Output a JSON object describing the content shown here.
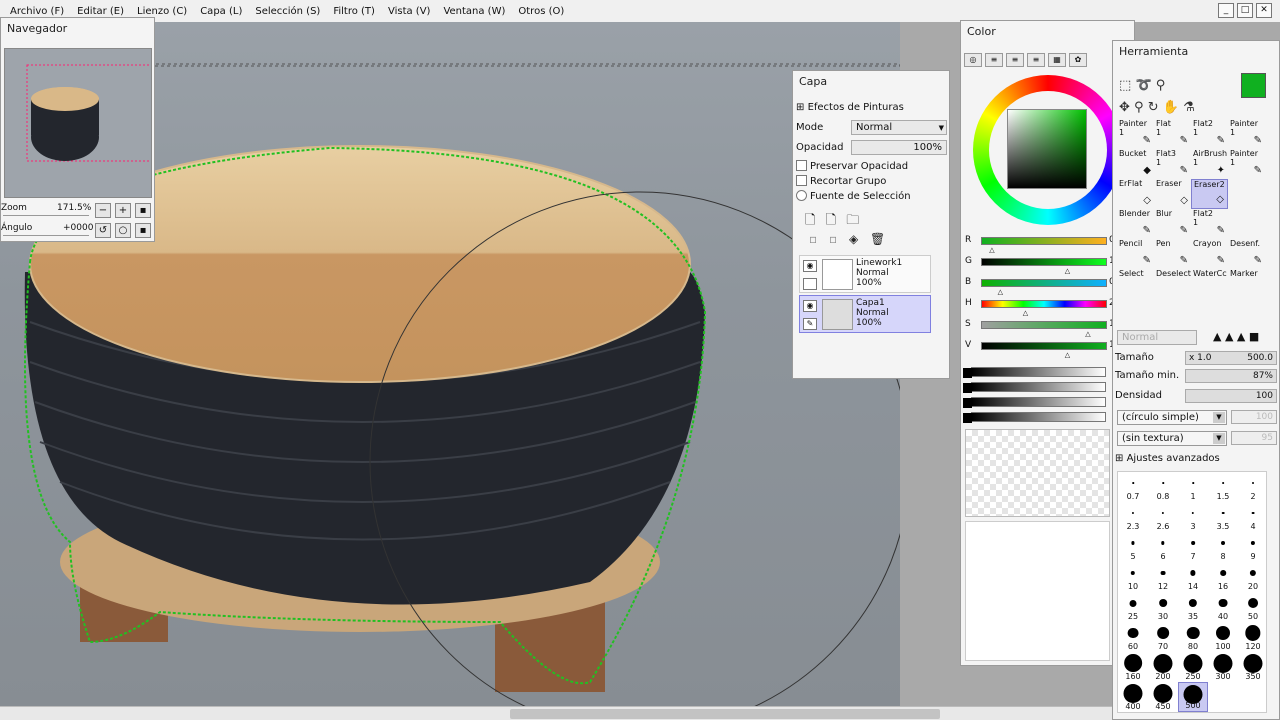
{
  "menu": [
    "Archivo (F)",
    "Editar (E)",
    "Lienzo (C)",
    "Capa (L)",
    "Selección (S)",
    "Filtro (T)",
    "Vista (V)",
    "Ventana (W)",
    "Otros (O)"
  ],
  "window_controls": [
    "_",
    "□",
    "✕"
  ],
  "navigator": {
    "title": "Navegador",
    "zoom_label": "Zoom",
    "zoom_value": "171.5%",
    "angle_label": "Ángulo",
    "angle_value": "+0000"
  },
  "layers": {
    "title": "Capa",
    "effects_label": "Efectos de Pinturas",
    "mode_label": "Mode",
    "mode_value": "Normal",
    "opacity_label": "Opacidad",
    "opacity_value": "100%",
    "preserve_opacity": "Preservar Opacidad",
    "clip_group": "Recortar Grupo",
    "selection_source": "Fuente de Selección",
    "items": [
      {
        "name": "Linework1",
        "mode": "Normal",
        "opacity": "100%"
      },
      {
        "name": "Capa1",
        "mode": "Normal",
        "opacity": "100%"
      }
    ]
  },
  "color": {
    "title": "Color",
    "current_hex": "#10b020",
    "channels": [
      {
        "label": "R",
        "value": "0",
        "level": 0.06
      },
      {
        "label": "G",
        "value": "1",
        "level": 0.69
      },
      {
        "label": "B",
        "value": "0",
        "level": 0.13
      },
      {
        "label": "H",
        "value": "2",
        "level": 0.34
      },
      {
        "label": "S",
        "value": "1",
        "level": 0.86
      },
      {
        "label": "V",
        "value": "1",
        "level": 0.69
      }
    ]
  },
  "tool": {
    "title": "Herramienta",
    "tools": [
      {
        "name": "Painter",
        "num": "1",
        "icon": "✎"
      },
      {
        "name": "Flat",
        "num": "1",
        "icon": "✎"
      },
      {
        "name": "Flat2",
        "num": "1",
        "icon": "✎"
      },
      {
        "name": "Painter",
        "num": "1",
        "icon": "✎"
      },
      {
        "name": "Bucket",
        "num": "",
        "icon": "◆"
      },
      {
        "name": "Flat3",
        "num": "1",
        "icon": "✎"
      },
      {
        "name": "AirBrush",
        "num": "1",
        "icon": "✦"
      },
      {
        "name": "Painter",
        "num": "1",
        "icon": "✎"
      },
      {
        "name": "ErFlat",
        "num": "",
        "icon": "◇"
      },
      {
        "name": "Eraser",
        "num": "",
        "icon": "◇"
      },
      {
        "name": "Eraser2",
        "num": "",
        "icon": "◇"
      },
      {
        "name": "",
        "num": "",
        "icon": ""
      },
      {
        "name": "Blender",
        "num": "",
        "icon": "✎"
      },
      {
        "name": "Blur",
        "num": "",
        "icon": "✎"
      },
      {
        "name": "Flat2",
        "num": "1",
        "icon": "✎"
      },
      {
        "name": "",
        "num": "",
        "icon": ""
      },
      {
        "name": "Pencil",
        "num": "",
        "icon": "✎"
      },
      {
        "name": "Pen",
        "num": "",
        "icon": "✎"
      },
      {
        "name": "Crayon",
        "num": "",
        "icon": "✎"
      },
      {
        "name": "Desenf.",
        "num": "",
        "icon": "✎"
      },
      {
        "name": "Select",
        "num": "",
        "icon": ""
      },
      {
        "name": "Deselect",
        "num": "",
        "icon": ""
      },
      {
        "name": "WaterCc",
        "num": "",
        "icon": ""
      },
      {
        "name": "Marker",
        "num": "",
        "icon": ""
      }
    ],
    "blend_value": "Normal",
    "size_label": "Tamaño",
    "size_mult": "x 1.0",
    "size_value": "500.0",
    "min_size_label": "Tamaño min.",
    "min_size_value": "87%",
    "density_label": "Densidad",
    "density_value": "100",
    "shape_value": "(círculo simple)",
    "shape_num": "100",
    "texture_value": "(sin textura)",
    "texture_num": "95",
    "advanced_label": "Ajustes avanzados",
    "brush_sizes": [
      "0.7",
      "0.8",
      "1",
      "1.5",
      "2",
      "2.3",
      "2.6",
      "3",
      "3.5",
      "4",
      "5",
      "6",
      "7",
      "8",
      "9",
      "10",
      "12",
      "14",
      "16",
      "20",
      "25",
      "30",
      "35",
      "40",
      "50",
      "60",
      "70",
      "80",
      "100",
      "120",
      "160",
      "200",
      "250",
      "300",
      "350",
      "400",
      "450",
      "500"
    ]
  }
}
